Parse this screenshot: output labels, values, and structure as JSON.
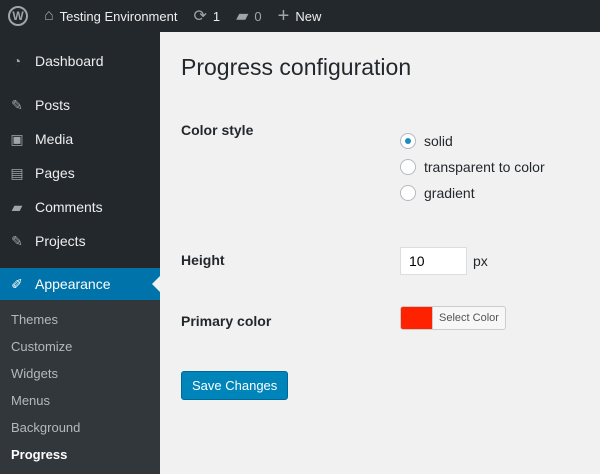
{
  "adminbar": {
    "site": "Testing Environment",
    "updates": "1",
    "comments": "0",
    "new": "New"
  },
  "sidebar": {
    "items": [
      {
        "label": "Dashboard",
        "icon": "dashboard-icon"
      },
      {
        "label": "Posts",
        "icon": "pin-icon"
      },
      {
        "label": "Media",
        "icon": "media-icon"
      },
      {
        "label": "Pages",
        "icon": "pages-icon"
      },
      {
        "label": "Comments",
        "icon": "comment-icon"
      },
      {
        "label": "Projects",
        "icon": "pin-icon"
      },
      {
        "label": "Appearance",
        "icon": "brush-icon"
      }
    ],
    "submenu": [
      "Themes",
      "Customize",
      "Widgets",
      "Menus",
      "Background",
      "Progress"
    ]
  },
  "main": {
    "title": "Progress configuration",
    "color_style": {
      "label": "Color style",
      "options": [
        "solid",
        "transparent to color",
        "gradient"
      ],
      "selected": "solid"
    },
    "height": {
      "label": "Height",
      "value": "10",
      "unit": "px"
    },
    "primary_color": {
      "label": "Primary color",
      "value": "#ff2200",
      "button": "Select Color"
    },
    "save": "Save Changes"
  }
}
